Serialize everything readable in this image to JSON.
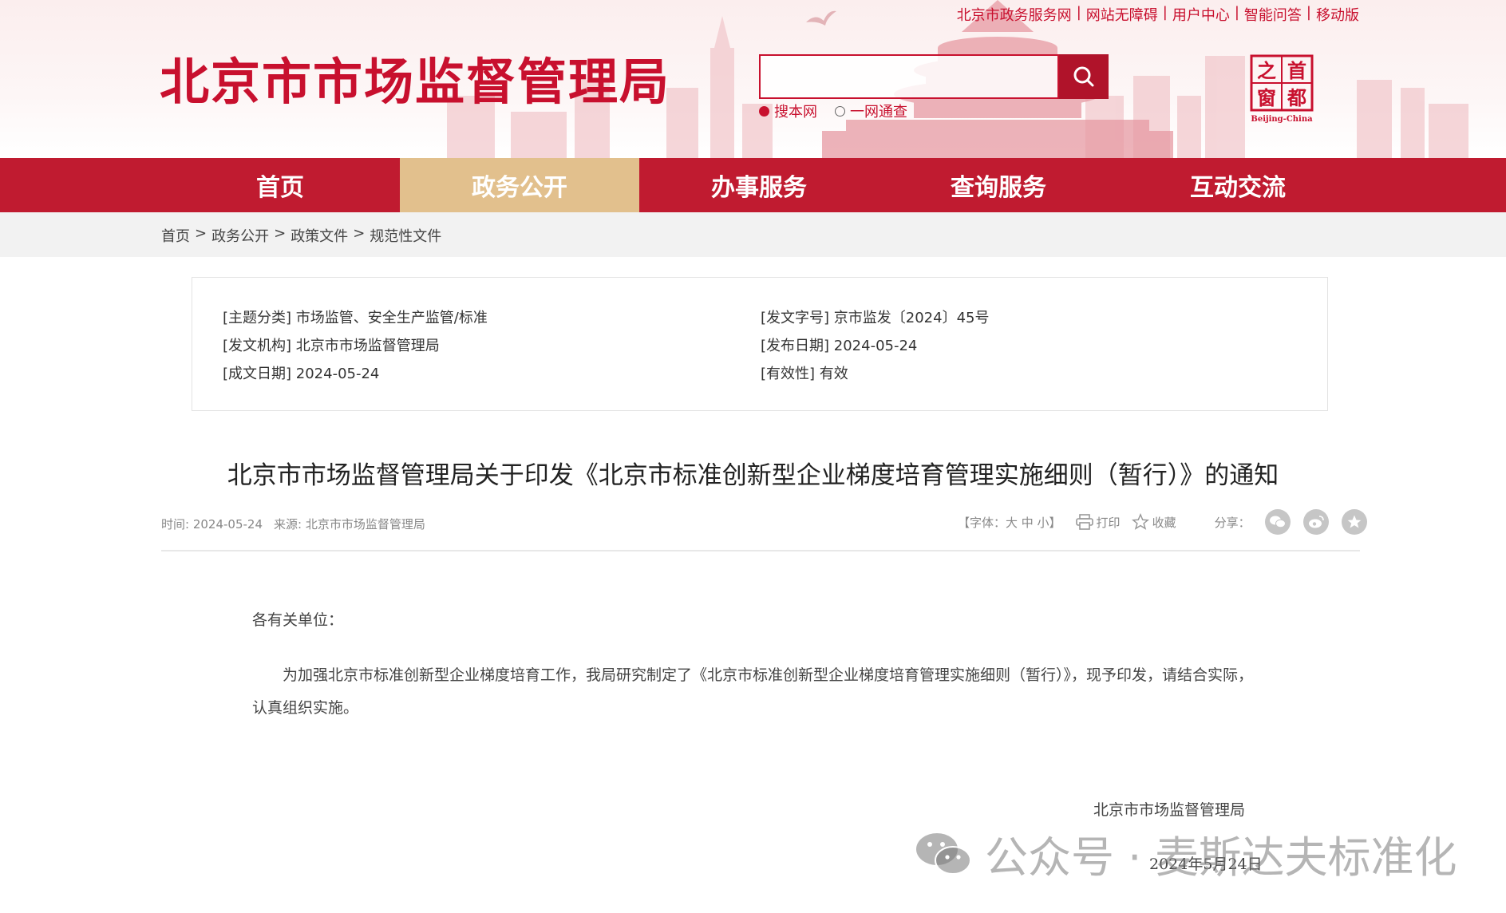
{
  "header": {
    "site_title": "北京市市场监督管理局",
    "top_links": [
      "北京市政务服务网",
      "网站无障碍",
      "用户中心",
      "智能问答",
      "移动版"
    ],
    "search_placeholder": "",
    "search_scopes": [
      {
        "label": "搜本网",
        "selected": true
      },
      {
        "label": "一网通查",
        "selected": false
      }
    ],
    "logo_chars": [
      "之",
      "首",
      "窗",
      "都"
    ],
    "logo_caption": "Beijing-China",
    "brand_color": "#c8102e"
  },
  "nav": {
    "items": [
      {
        "label": "首页",
        "active": false
      },
      {
        "label": "政务公开",
        "active": true
      },
      {
        "label": "办事服务",
        "active": false
      },
      {
        "label": "查询服务",
        "active": false
      },
      {
        "label": "互动交流",
        "active": false
      }
    ],
    "bar_color": "#c01b30",
    "active_color": "#e2c08d"
  },
  "breadcrumb": [
    "首页",
    "政务公开",
    "政策文件",
    "规范性文件"
  ],
  "meta": {
    "topic": {
      "key": "[主题分类]",
      "value": "市场监管、安全生产监管/标准"
    },
    "doc_no": {
      "key": "[发文字号]",
      "value": "京市监发〔2024〕45号"
    },
    "issuer": {
      "key": "[发文机构]",
      "value": "北京市市场监督管理局"
    },
    "publish_date": {
      "key": "[发布日期]",
      "value": "2024-05-24"
    },
    "written_date": {
      "key": "[成文日期]",
      "value": "2024-05-24"
    },
    "validity": {
      "key": "[有效性]",
      "value": "有效"
    }
  },
  "article": {
    "title": "北京市市场监督管理局关于印发《北京市标准创新型企业梯度培育管理实施细则（暂行）》的通知",
    "time": "时间: 2024-05-24",
    "source": "来源: 北京市市场监督管理局",
    "font_label": "【字体：大 中 小】",
    "print_label": "打印",
    "favorite_label": "收藏",
    "share_label": "分享：",
    "salutation": "各有关单位：",
    "paragraph": "为加强北京市标准创新型企业梯度培育工作，我局研究制定了《北京市标准创新型企业梯度培育管理实施细则（暂行）》，现予印发，请结合实际，认真组织实施。",
    "signer": "北京市市场监督管理局",
    "sign_date": "2024年5月24日"
  },
  "watermark": {
    "text": "公众号 · 麦斯达夫标准化"
  }
}
